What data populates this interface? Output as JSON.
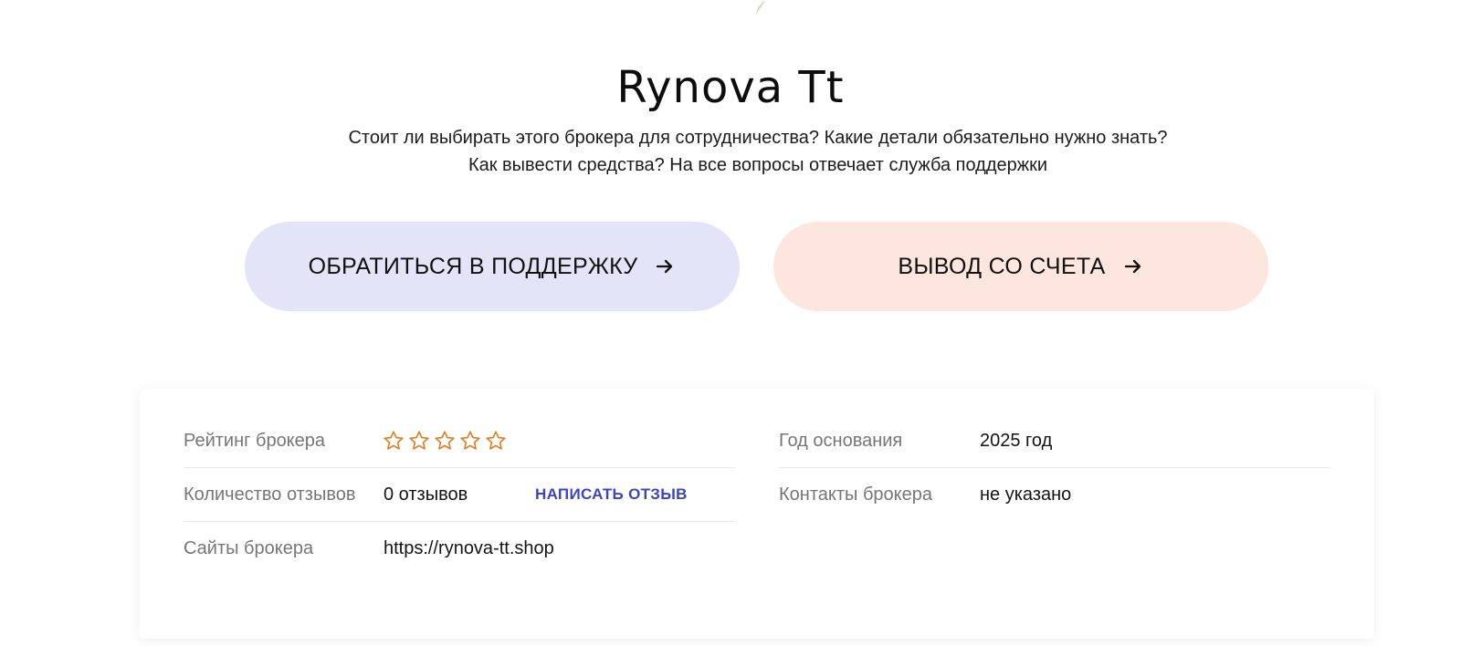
{
  "broker": {
    "name": "Rynova Tt",
    "description": "Стоит ли выбирать этого брокера для сотрудничества? Какие детали обязательно нужно знать? Как вывести средства? На все вопросы отвечает служба поддержки"
  },
  "actions": {
    "support_label": "ОБРАТИТЬСЯ В ПОДДЕРЖКУ",
    "withdraw_label": "ВЫВОД СО СЧЕТА"
  },
  "details": {
    "rating_label": "Рейтинг брокера",
    "rating_value": 0,
    "rating_max": 5,
    "reviews_label": "Количество отзывов",
    "reviews_value": "0 отзывов",
    "write_review_label": "НАПИСАТЬ ОТЗЫВ",
    "sites_label": "Сайты брокера",
    "sites_value": "https://rynova-tt.shop",
    "founded_label": "Год основания",
    "founded_value": "2025 год",
    "contacts_label": "Контакты брокера",
    "contacts_value": "не указано"
  },
  "colors": {
    "support_bg": "#e3e4f8",
    "withdraw_bg": "#fce6de",
    "star_outline": "#e07b1f",
    "link": "#3d44c4"
  },
  "icons": {
    "cta_arrow": "arrow-right-icon",
    "rating_star": "star-outline-icon",
    "decoration": "leaf-icon"
  }
}
